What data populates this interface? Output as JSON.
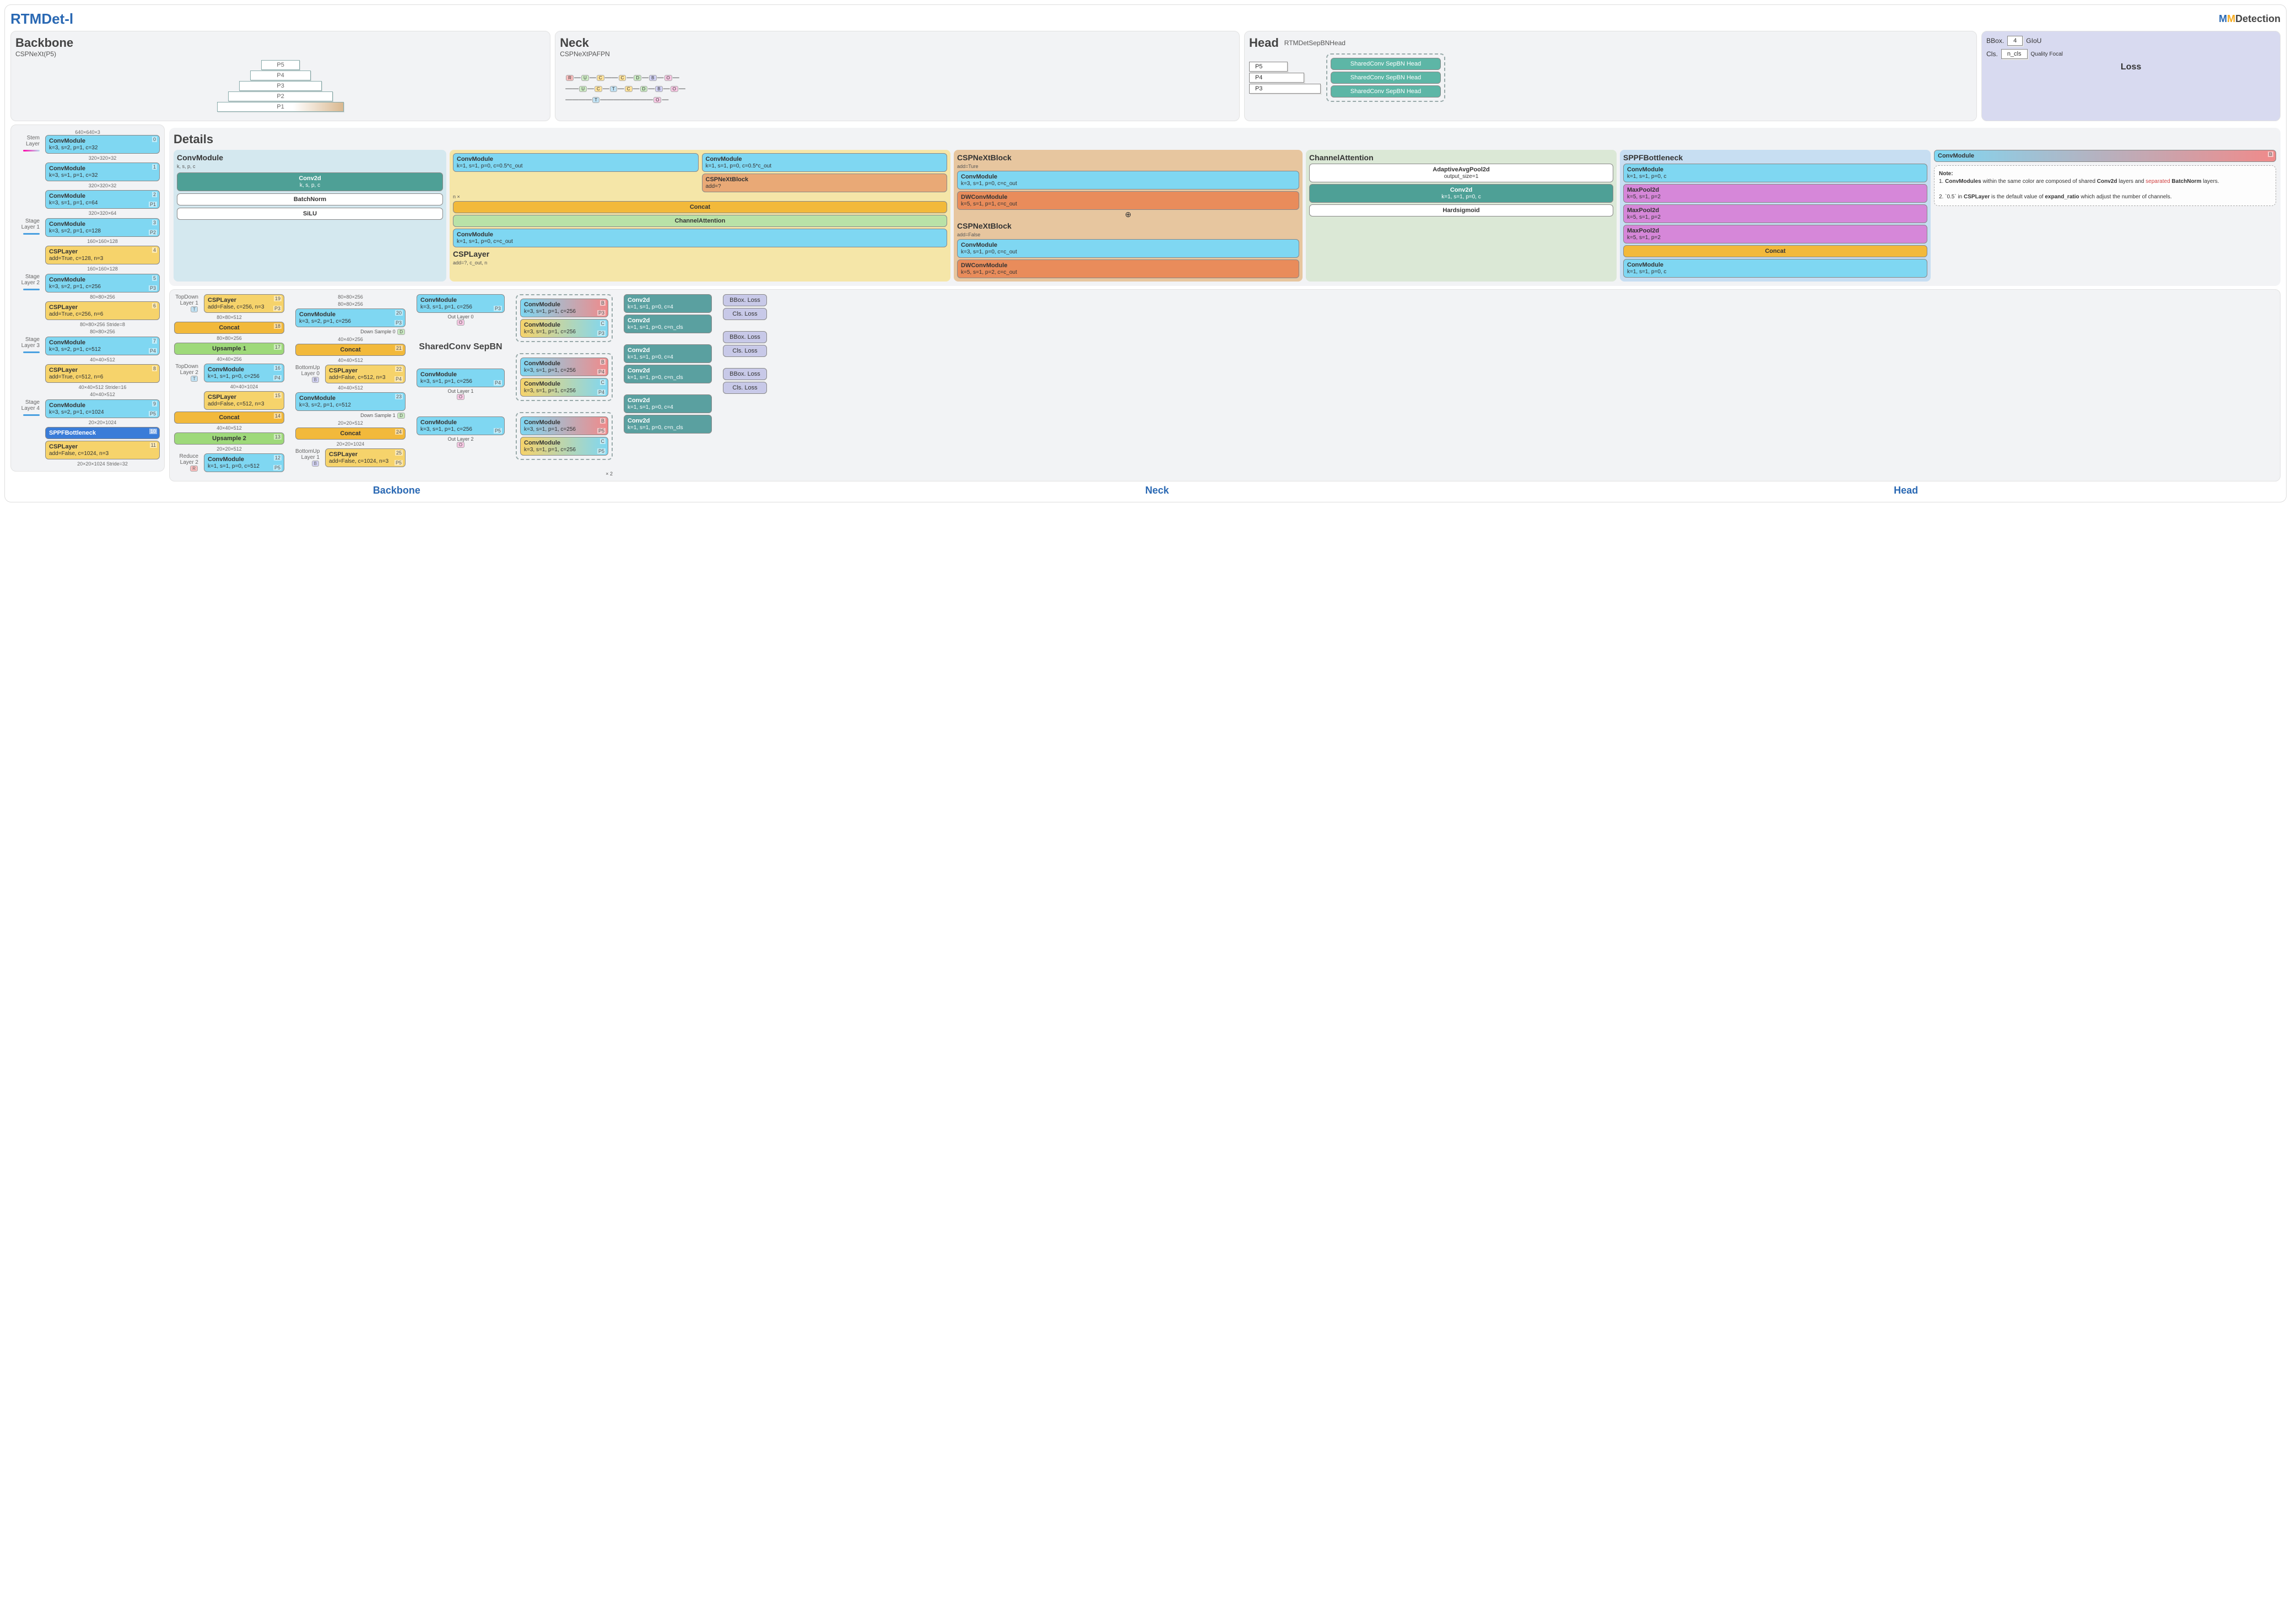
{
  "title": "RTMDet-l",
  "logo": {
    "m1": "M",
    "m2": "M",
    "tx": "Detection"
  },
  "backbone": {
    "title": "Backbone",
    "sub": "CSPNeXt(P5)",
    "levels": [
      "P5",
      "P4",
      "P3",
      "P2",
      "P1"
    ],
    "widths": [
      70,
      110,
      150,
      190,
      230
    ],
    "input": "640×640×3",
    "stem": {
      "label": "Stem Layer",
      "items": [
        {
          "t": "ConvModule",
          "p": "k=3, s=2, p=1, c=32",
          "id": "0",
          "out": "320×320×32"
        },
        {
          "t": "ConvModule",
          "p": "k=3, s=1, p=1, c=32",
          "id": "1",
          "out": "320×320×32"
        },
        {
          "t": "ConvModule",
          "p": "k=3, s=1, p=1, c=64",
          "id": "2",
          "pl": "P1",
          "out": "320×320×64"
        }
      ]
    },
    "s1": {
      "label": "Stage Layer 1",
      "items": [
        {
          "t": "ConvModule",
          "p": "k=3, s=2, p=1, c=128",
          "id": "3",
          "pl": "P2",
          "out": "160×160×128"
        },
        {
          "t": "CSPLayer",
          "p": "add=True, c=128, n=3",
          "id": "4",
          "out": "160×160×128",
          "cls": "bg-csp"
        }
      ]
    },
    "s2": {
      "label": "Stage Layer 2",
      "items": [
        {
          "t": "ConvModule",
          "p": "k=3, s=2, p=1, c=256",
          "id": "5",
          "pl": "P3",
          "out": "80×80×256"
        },
        {
          "t": "CSPLayer",
          "p": "add=True, c=256, n=6",
          "id": "6",
          "out": "80×80×256",
          "cls": "bg-csp",
          "side": "80×80×256 Stride=8"
        }
      ]
    },
    "s3": {
      "label": "Stage Layer 3",
      "items": [
        {
          "t": "ConvModule",
          "p": "k=3, s=2, p=1, c=512",
          "id": "7",
          "pl": "P4",
          "out": "40×40×512"
        },
        {
          "t": "CSPLayer",
          "p": "add=True, c=512, n=6",
          "id": "8",
          "out": "40×40×512",
          "cls": "bg-csp",
          "side": "40×40×512 Stride=16"
        }
      ]
    },
    "s4": {
      "label": "Stage Layer 4",
      "items": [
        {
          "t": "ConvModule",
          "p": "k=3, s=2, p=1, c=1024",
          "id": "9",
          "pl": "P5",
          "out": "20×20×1024"
        },
        {
          "t": "SPPFBottleneck",
          "p": "",
          "id": "10",
          "cls": "bg-sppf"
        },
        {
          "t": "CSPLayer",
          "p": "add=False, c=1024, n=3",
          "id": "11",
          "out": "",
          "cls": "bg-csp",
          "side": "20×20×1024 Stride=32"
        }
      ]
    }
  },
  "neck": {
    "title": "Neck",
    "sub": "CSPNeXtPAFPN",
    "td1": {
      "label": "TopDown Layer 1",
      "item": {
        "t": "CSPLayer",
        "p": "add=False, c=256, n=3",
        "id": "19",
        "pl": "P3",
        "out": "80×80×256"
      }
    },
    "concat18": {
      "t": "Concat",
      "id": "18",
      "out": "80×80×512",
      "in": "80×80×256"
    },
    "up1": {
      "t": "Upsample 1",
      "id": "17",
      "out": "40×40×256"
    },
    "td2": {
      "label": "TopDown Layer 2",
      "items": [
        {
          "t": "ConvModule",
          "p": "k=1, s=1, p=0, c=256",
          "id": "16",
          "pl": "P4",
          "out": "40×40×256"
        },
        {
          "t": "CSPLayer",
          "p": "add=False, c=512, n=3",
          "id": "15",
          "cls": "bg-csp",
          "out": "40×40×1024"
        }
      ]
    },
    "concat14": {
      "t": "Concat",
      "id": "14",
      "out": "40×40×512"
    },
    "up2": {
      "t": "Upsample 2",
      "id": "13",
      "out": "20×20×512"
    },
    "red2": {
      "label": "Reduce Layer 2",
      "item": {
        "t": "ConvModule",
        "p": "k=1, s=1, p=0, c=512",
        "id": "12",
        "pl": "P5",
        "out": "20×20×512"
      }
    },
    "cm20": {
      "t": "ConvModule",
      "p": "k=3, s=2, p=1, c=256",
      "id": "20",
      "pl": "P3",
      "lbl": "Down Sample 0",
      "out": "80×80×256"
    },
    "concat21": {
      "t": "Concat",
      "id": "21",
      "in": "40×40×256",
      "out": "40×40×512"
    },
    "bu0": {
      "label": "BottomUp Layer 0",
      "item": {
        "t": "CSPLayer",
        "p": "add=False, c=512, n=3",
        "id": "22",
        "pl": "P4",
        "out": "40×40×512"
      }
    },
    "cm23": {
      "t": "ConvModule",
      "p": "k=3, s=2, p=1, c=512",
      "id": "23",
      "lbl": "Down Sample 1",
      "out": "40×40×512"
    },
    "concat24": {
      "t": "Concat",
      "id": "24",
      "in": "20×20×512",
      "out": "20×20×1024"
    },
    "bu1": {
      "label": "BottomUp Layer 1",
      "item": {
        "t": "CSPLayer",
        "p": "add=False, c=1024, n=3",
        "id": "25",
        "pl": "P5",
        "out": "20×20×1024"
      }
    },
    "out0": {
      "t": "ConvModule",
      "p": "k=3, s=1, p=1, c=256",
      "pl": "P3",
      "lbl": "Out Layer 0"
    },
    "out1": {
      "t": "ConvModule",
      "p": "k=3, s=1, p=1, c=256",
      "pl": "P4",
      "lbl": "Out Layer 1"
    },
    "out2": {
      "t": "ConvModule",
      "p": "k=3, s=1, p=1, c=256",
      "pl": "P5",
      "lbl": "Out Layer 2"
    }
  },
  "head": {
    "title": "Head",
    "sub": "RTMDetSepBNHead",
    "levels": [
      "P5",
      "P4",
      "P3"
    ],
    "shared": "SharedConv SepBN Head",
    "items": [
      {
        "b": {
          "t": "ConvModule",
          "p": "k=3, s=1, p=1, c=256",
          "pl": "P3",
          "badge": "B"
        },
        "c": {
          "t": "ConvModule",
          "p": "k=3, s=1, p=1, c=256",
          "pl": "P3",
          "badge": "C"
        }
      },
      {
        "b": {
          "t": "ConvModule",
          "p": "k=3, s=1, p=1, c=256",
          "pl": "P4",
          "badge": "B"
        },
        "c": {
          "t": "ConvModule",
          "p": "k=3, s=1, p=1, c=256",
          "pl": "P4",
          "badge": "C"
        }
      },
      {
        "b": {
          "t": "ConvModule",
          "p": "k=3, s=1, p=1, c=256",
          "pl": "P5",
          "badge": "B"
        },
        "c": {
          "t": "ConvModule",
          "p": "k=3, s=1, p=1, c=256",
          "pl": "P5",
          "badge": "C"
        }
      }
    ],
    "conv2d_b": {
      "t": "Conv2d",
      "p": "k=1, s=1, p=0, c=4"
    },
    "conv2d_c": {
      "t": "Conv2d",
      "p": "k=1, s=1, p=0, c=n_cls"
    },
    "loss_b": "BBox. Loss",
    "loss_c": "Cls. Loss",
    "repeat": "× 2",
    "shared_title": "SharedConv SepBN"
  },
  "lossbox": {
    "title": "Loss",
    "bb": "BBox.",
    "bv": "4",
    "bt": "GIoU",
    "cl": "Cls.",
    "cv": "n_cls",
    "ct": "Quality Focal"
  },
  "details": {
    "title": "Details",
    "convmod": {
      "h": "ConvModule",
      "sub": "k, s, p, c",
      "a": "Conv2d",
      "ap": "k, s, p, c",
      "b": "BatchNorm",
      "c": "SiLU"
    },
    "csplayer": {
      "h": "CSPLayer",
      "sub": "add=?, c_out, n",
      "cm1": "ConvModule",
      "cm1p": "k=1, s=1, p=0, c=0.5*c_out",
      "cm2": "ConvModule",
      "cm2p": "k=1, s=1, p=0, c=0.5*c_out",
      "blk": "CSPNeXtBlock",
      "blkp": "add=?",
      "nx": "n ×",
      "cc": "Concat",
      "ca": "ChannelAttention",
      "cm3": "ConvModule",
      "cm3p": "k=1, s=1, p=0, c=c_out"
    },
    "cspnext_t": {
      "h": "CSPNeXtBlock",
      "sub": "add=Ture",
      "a": "ConvModule",
      "ap": "k=3, s=1, p=0, c=c_out",
      "b": "DWConvModule",
      "bp": "k=5, s=1, p=1, c=c_out"
    },
    "cspnext_f": {
      "h": "CSPNeXtBlock",
      "sub": "add=False",
      "a": "ConvModule",
      "ap": "k=3, s=1, p=0, c=c_out",
      "b": "DWConvModule",
      "bp": "k=5, s=1, p=2, c=c_out"
    },
    "chattn": {
      "h": "ChannelAttention",
      "a": "AdaptiveAvgPool2d",
      "ap": "output_size=1",
      "b": "Conv2d",
      "bp": "k=1, s=1, p=0, c",
      "c": "Hardsigmoid"
    },
    "sppf": {
      "h": "SPPFBottleneck",
      "a": "ConvModule",
      "ap": "k=1, s=1, p=0, c",
      "mp": "MaxPool2d",
      "mpp": "k=5, s=1, p=2",
      "cc": "Concat",
      "b": "ConvModule",
      "bp": "k=1, s=1, p=0, c"
    },
    "legend": {
      "cm": "ConvModule",
      "badge": "B",
      "note_h": "Note:",
      "n1a": "1. ",
      "n1b": "ConvModules",
      "n1c": " within the same color are composed of shared ",
      "n1d": "Conv2d",
      "n1e": " layers and ",
      "n1f": "separated",
      "n1g": " BatchNorm",
      "n1h": " layers.",
      "n2a": "2. `0.5` in ",
      "n2b": "CSPLayer",
      "n2c": " is the default value of ",
      "n2d": "expand_ratio",
      "n2e": " which adjust the number of channels."
    }
  },
  "foot": {
    "a": "Backbone",
    "b": "Neck",
    "c": "Head"
  }
}
